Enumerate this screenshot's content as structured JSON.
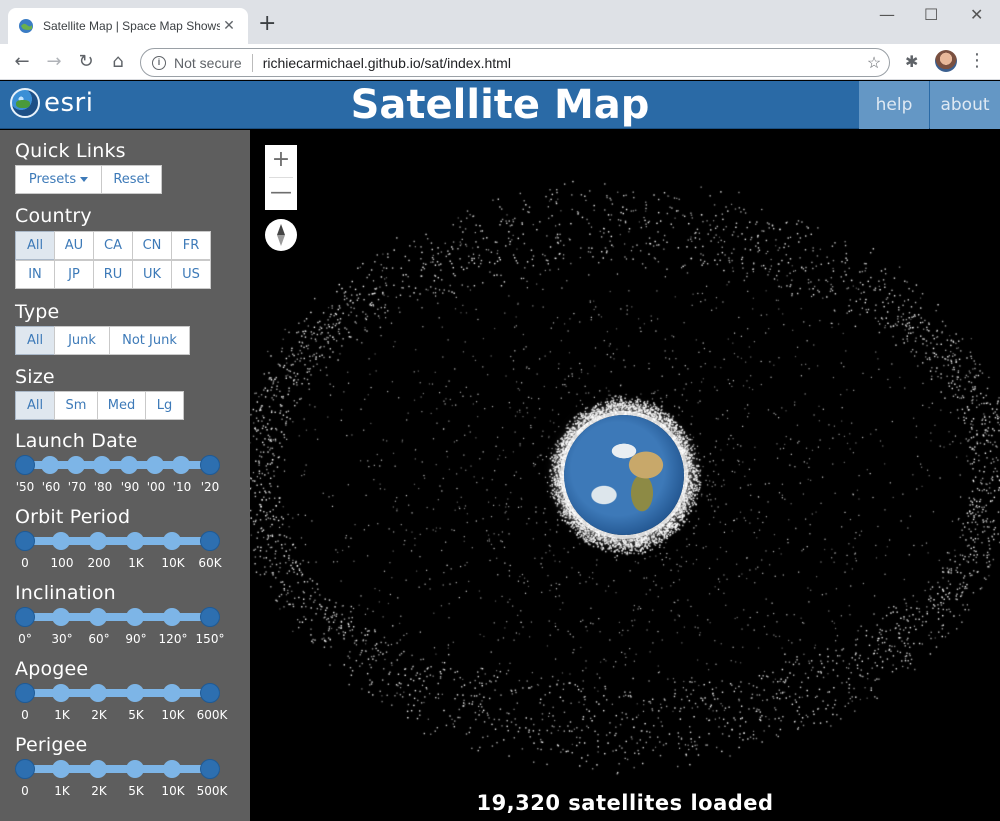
{
  "browser": {
    "tab_title": "Satellite Map | Space Map Shows",
    "new_tab": "+",
    "security_label": "Not secure",
    "url": "richiecarmichael.github.io/sat/index.html"
  },
  "header": {
    "logo_text": "esri",
    "title": "Satellite Map",
    "help_label": "help",
    "about_label": "about"
  },
  "sidebar": {
    "quick_links": {
      "title": "Quick Links",
      "presets_label": "Presets",
      "reset_label": "Reset"
    },
    "country": {
      "title": "Country",
      "options": [
        "All",
        "AU",
        "CA",
        "CN",
        "FR",
        "IN",
        "JP",
        "RU",
        "UK",
        "US"
      ],
      "selected": "All"
    },
    "type": {
      "title": "Type",
      "options": [
        "All",
        "Junk",
        "Not Junk"
      ],
      "selected": "All"
    },
    "size": {
      "title": "Size",
      "options": [
        "All",
        "Sm",
        "Med",
        "Lg"
      ],
      "selected": "All"
    },
    "launch_date": {
      "title": "Launch Date",
      "ticks": [
        "'50",
        "'60",
        "'70",
        "'80",
        "'90",
        "'00",
        "'10",
        "'20"
      ]
    },
    "orbit_period": {
      "title": "Orbit Period",
      "ticks": [
        "0",
        "100",
        "200",
        "1K",
        "10K",
        "60K"
      ]
    },
    "inclination": {
      "title": "Inclination",
      "ticks": [
        "0°",
        "30°",
        "60°",
        "90°",
        "120°",
        "150°"
      ]
    },
    "apogee": {
      "title": "Apogee",
      "ticks": [
        "0",
        "1K",
        "2K",
        "5K",
        "10K",
        "600K"
      ]
    },
    "perigee": {
      "title": "Perigee",
      "ticks": [
        "0",
        "1K",
        "2K",
        "5K",
        "10K",
        "500K"
      ]
    }
  },
  "map": {
    "zoom_in": "+",
    "zoom_out": "—",
    "status": "19,320 satellites loaded"
  },
  "colors": {
    "header_bg": "#2a6aa6",
    "sidebar_bg": "#5e5e5e",
    "slider_track": "#7db5e7",
    "slider_handle": "#2d6fb0"
  }
}
